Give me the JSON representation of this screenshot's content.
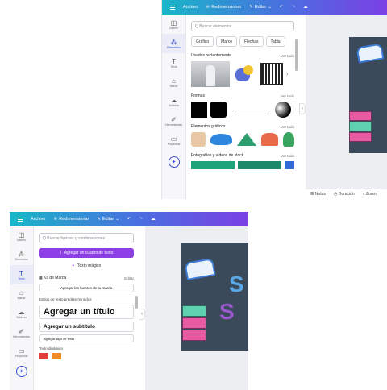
{
  "shot1": {
    "topbar": {
      "file": "Archivo",
      "resize": "Redimensionar",
      "edit": "Editar"
    },
    "rail": [
      "Diseño",
      "Elementos",
      "Texto",
      "Marca",
      "Subidos",
      "Herramientas",
      "Proyectos"
    ],
    "search_placeholder": "Q Buscar elementos",
    "chips": [
      "Gráfico",
      "Marco",
      "Flechas",
      "Tabla"
    ],
    "sections": [
      {
        "title": "Usados recientemente",
        "more": "Ver todo"
      },
      {
        "title": "Formas",
        "more": "Ver todo"
      },
      {
        "title": "Elementos gráficos",
        "more": "Ver todo"
      },
      {
        "title": "Fotografías y vídeos de stock",
        "more": "Ver todo"
      }
    ],
    "bottom": {
      "notes": "Notas",
      "timer": "Duración",
      "zoom": "Zoom"
    }
  },
  "shot2": {
    "topbar": {
      "file": "Archivo",
      "resize": "Redimensionar",
      "edit": "Editar"
    },
    "rail": [
      "Diseño",
      "Elementos",
      "Texto",
      "Marca",
      "Subidos",
      "Herramientas",
      "Proyectos"
    ],
    "search_placeholder": "Q Buscar fuentes y combinaciones",
    "add_box": "Agregar un cuadro de texto",
    "magic": "Texto mágico",
    "brand_kit": "Kit de Marca",
    "brand_edit": "Editar",
    "brand_fonts": "Agregar las fuentes de tu marca",
    "default_styles": "Estilos de texto predeterminados",
    "h1": "Agregar un título",
    "h2": "Agregar un subtítulo",
    "body": "Agregar algo de texto",
    "dynamic": "Texto dinámico"
  }
}
